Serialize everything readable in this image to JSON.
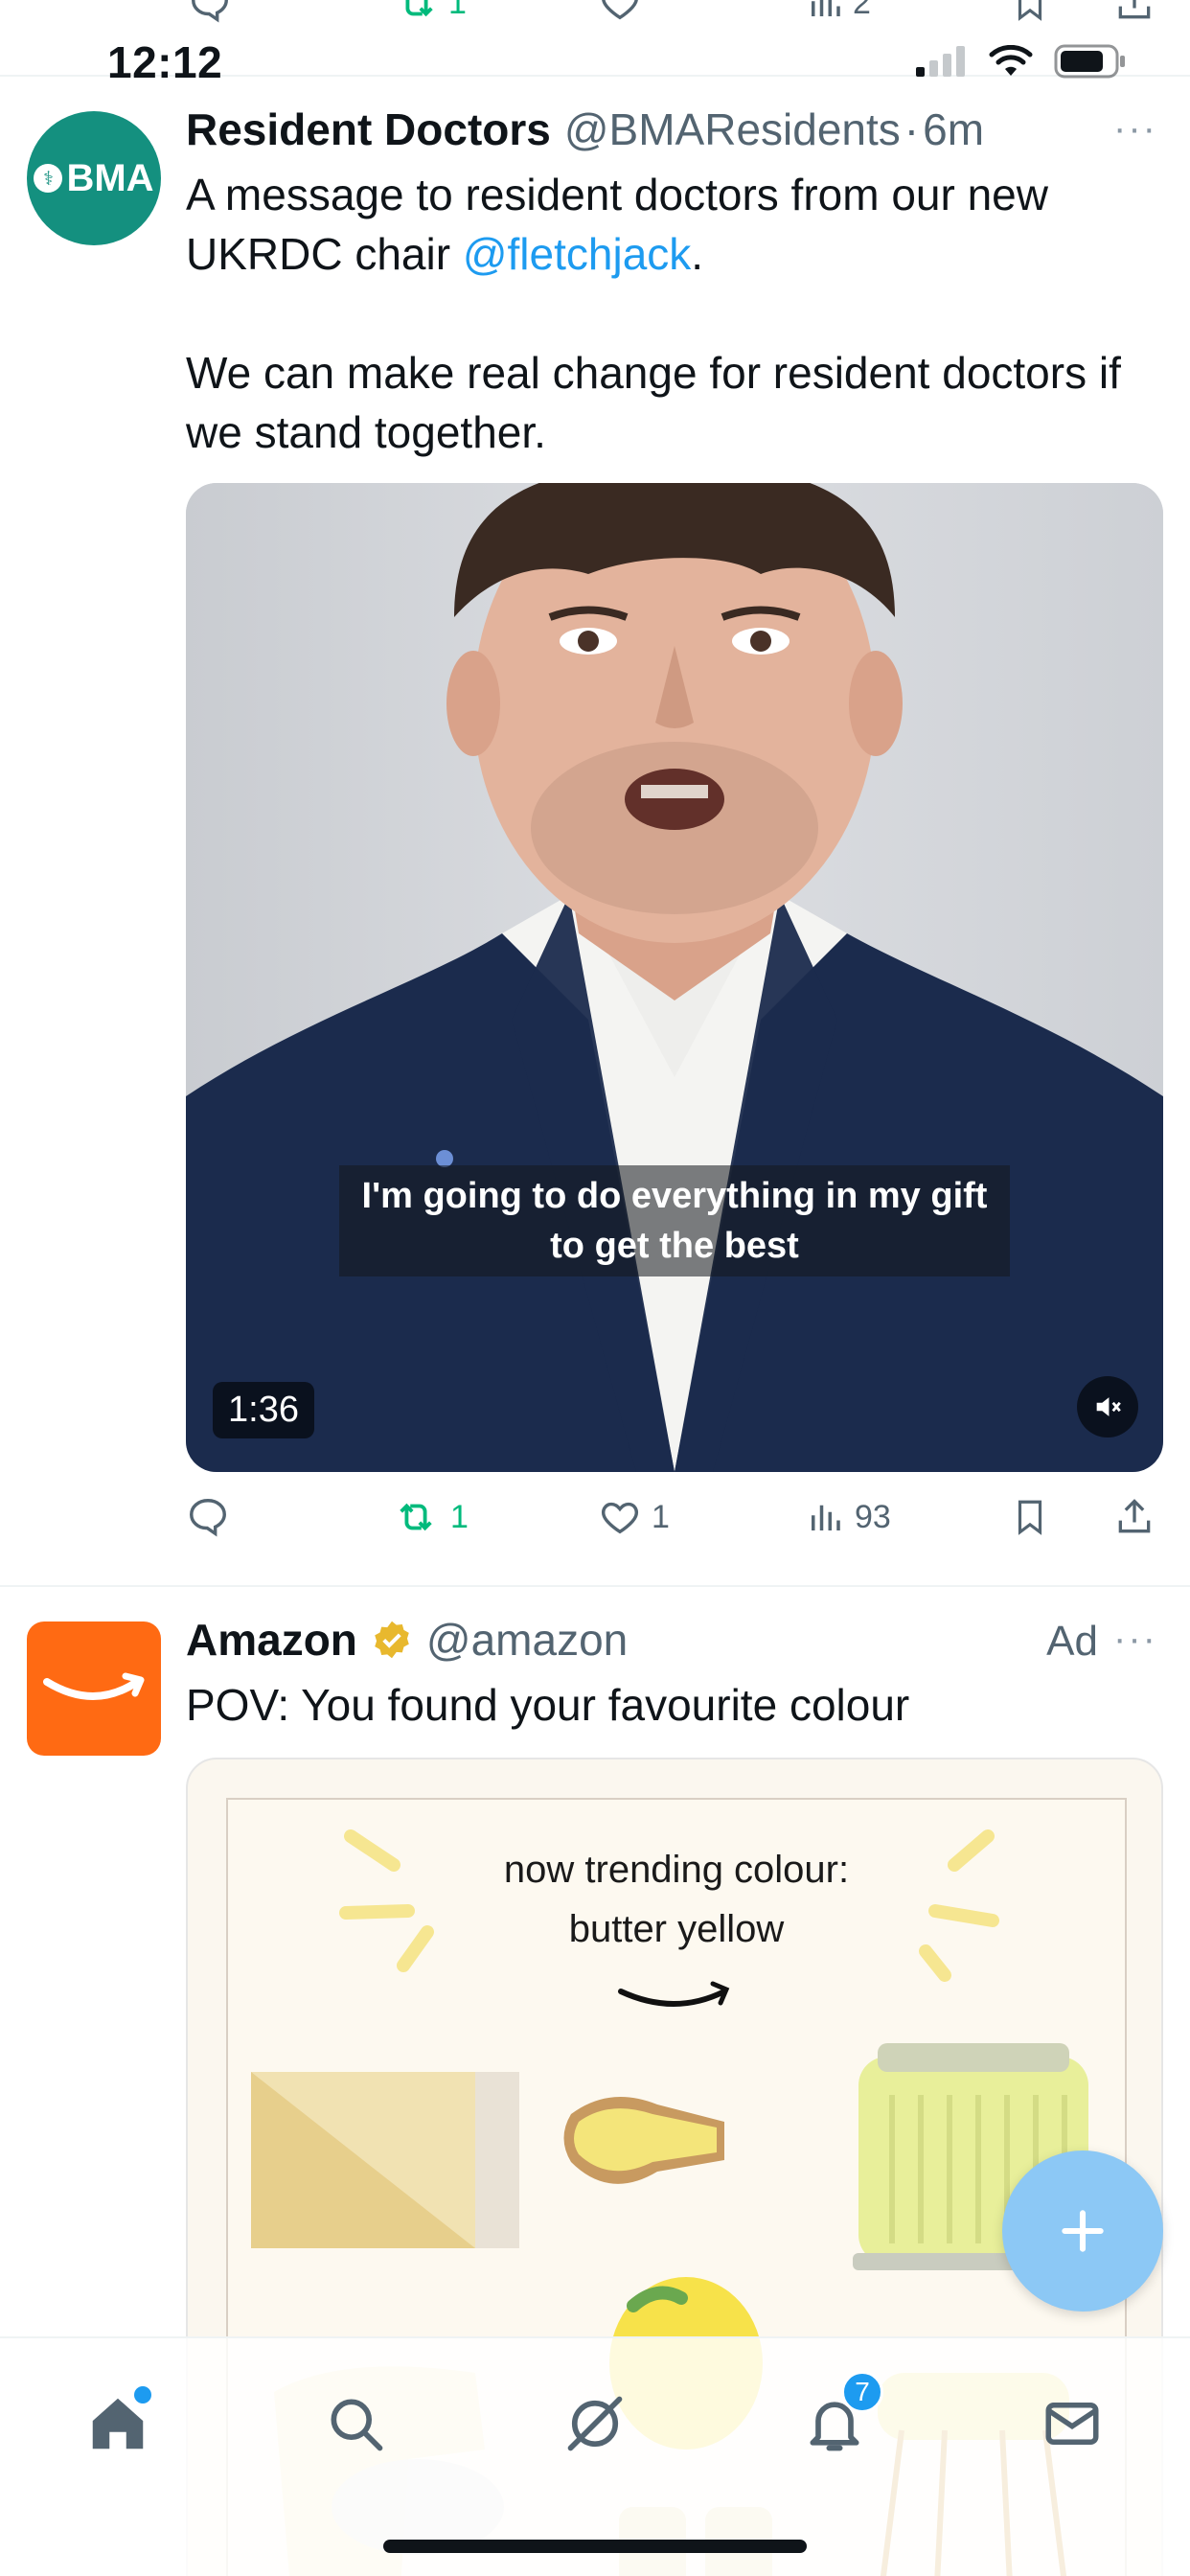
{
  "status_bar": {
    "time": "12:12"
  },
  "previous_tweet_actions": {
    "retweets": "1",
    "views": "2"
  },
  "tweet1": {
    "avatar_text": "BMA",
    "name": "Resident Doctors",
    "handle": "@BMAResidents",
    "separator": "·",
    "time": "6m",
    "more": "···",
    "text_line1": "A message to resident doctors from our new",
    "text_line2_prefix": "UKRDC chair ",
    "mention": "@fletchjack",
    "text_line2_suffix": ".",
    "text_line3": "We can make real change for resident doctors if",
    "text_line4": "we stand together.",
    "video": {
      "caption_line1": "I'm going to do everything in my gift",
      "caption_line2": "to get the best",
      "duration": "1:36"
    },
    "actions": {
      "replies": "",
      "retweets": "1",
      "likes": "1",
      "views": "93"
    }
  },
  "tweet2": {
    "name": "Amazon",
    "handle": "@amazon",
    "ad_label": "Ad",
    "more": "···",
    "text": "POV: You found your favourite colour",
    "card": {
      "title_line1": "now trending colour:",
      "title_line2": "butter yellow"
    }
  },
  "fab_icon": "plus-icon",
  "nav": {
    "items": [
      "home-icon",
      "search-icon",
      "grok-icon",
      "notifications-icon",
      "messages-icon"
    ],
    "notifications_badge": "7"
  },
  "colors": {
    "accent": "#1d9bf0",
    "retweet_green": "#00ba7c",
    "bma_teal": "#14907f",
    "amazon_orange": "#ff6a13",
    "verified_gold": "#e8b82e",
    "butter_yellow": "#f2e98a"
  }
}
